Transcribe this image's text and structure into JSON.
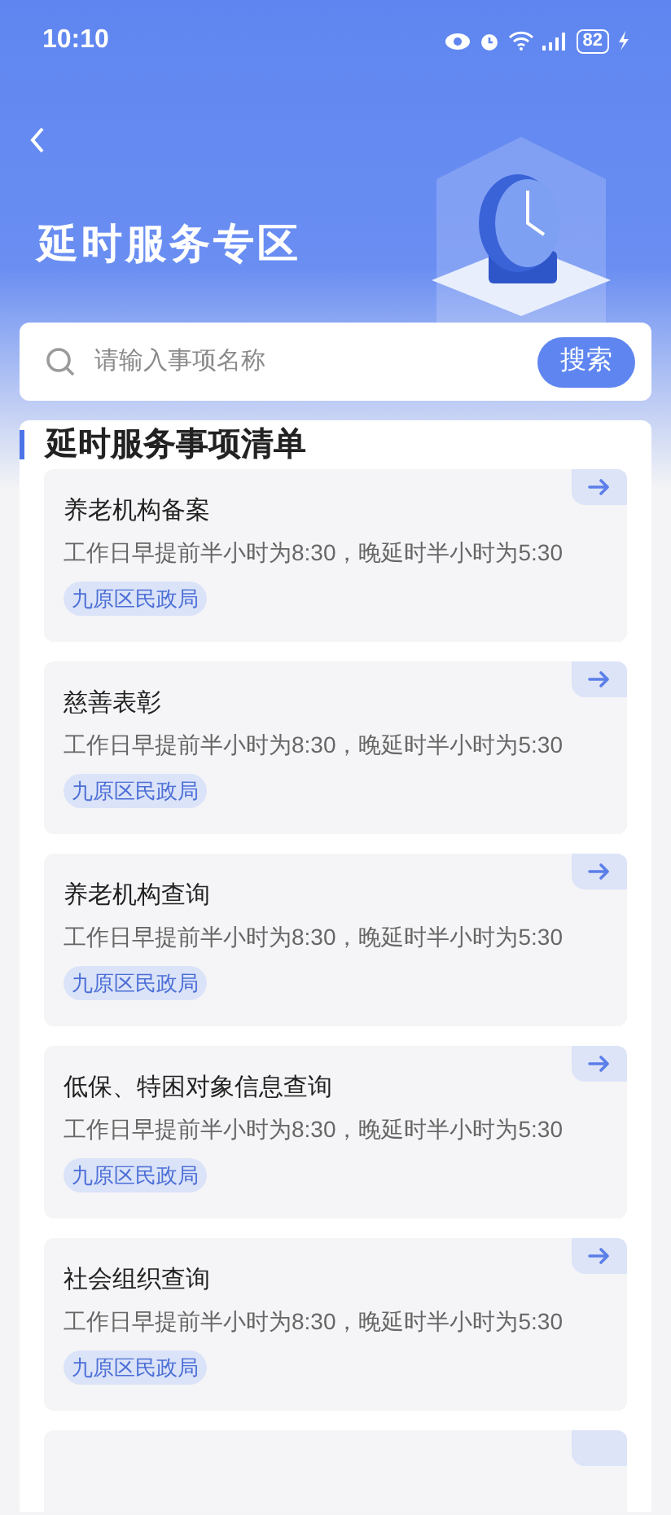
{
  "status_bar": {
    "time": "10:10",
    "battery": "82"
  },
  "header": {
    "title": "延时服务专区"
  },
  "search": {
    "placeholder": "请输入事项名称",
    "button": "搜索"
  },
  "list": {
    "title": "延时服务事项清单",
    "items": [
      {
        "name": "养老机构备案",
        "hours": "工作日早提前半小时为8:30，晚延时半小时为5:30",
        "department": "九原区民政局"
      },
      {
        "name": "慈善表彰",
        "hours": "工作日早提前半小时为8:30，晚延时半小时为5:30",
        "department": "九原区民政局"
      },
      {
        "name": "养老机构查询",
        "hours": "工作日早提前半小时为8:30，晚延时半小时为5:30",
        "department": "九原区民政局"
      },
      {
        "name": "低保、特困对象信息查询",
        "hours": "工作日早提前半小时为8:30，晚延时半小时为5:30",
        "department": "九原区民政局"
      },
      {
        "name": "社会组织查询",
        "hours": "工作日早提前半小时为8:30，晚延时半小时为5:30",
        "department": "九原区民政局"
      }
    ]
  }
}
